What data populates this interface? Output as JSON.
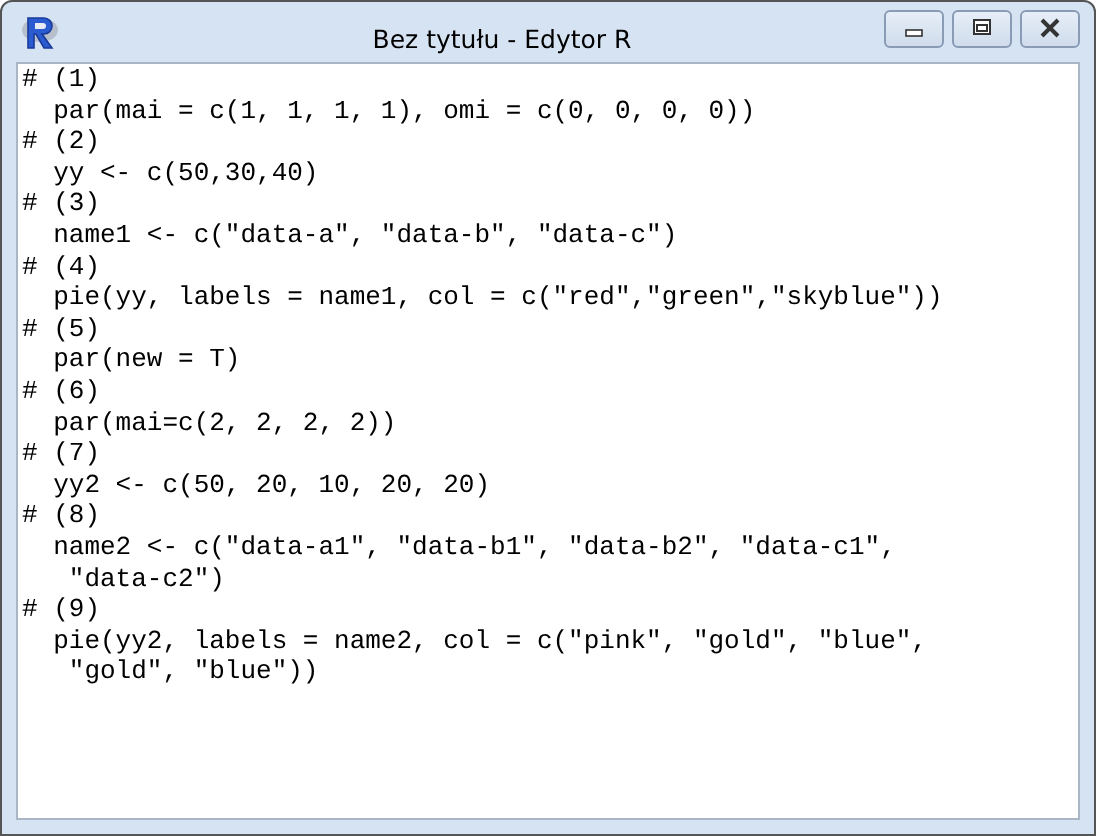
{
  "window": {
    "title": "Bez tytułu - Edytor R"
  },
  "editor": {
    "lines": [
      "# (1)",
      "  par(mai = c(1, 1, 1, 1), omi = c(0, 0, 0, 0))",
      "# (2)",
      "  yy <- c(50,30,40)",
      "# (3)",
      "  name1 <- c(\"data-a\", \"data-b\", \"data-c\")",
      "# (4)",
      "  pie(yy, labels = name1, col = c(\"red\",\"green\",\"skyblue\"))",
      "# (5)",
      "  par(new = T)",
      "# (6)",
      "  par(mai=c(2, 2, 2, 2))",
      "# (7)",
      "  yy2 <- c(50, 20, 10, 20, 20)",
      "# (8)",
      "  name2 <- c(\"data-a1\", \"data-b1\", \"data-b2\", \"data-c1\",",
      "   \"data-c2\")",
      "# (9)",
      "  pie(yy2, labels = name2, col = c(\"pink\", \"gold\", \"blue\",",
      "   \"gold\", \"blue\"))"
    ]
  }
}
